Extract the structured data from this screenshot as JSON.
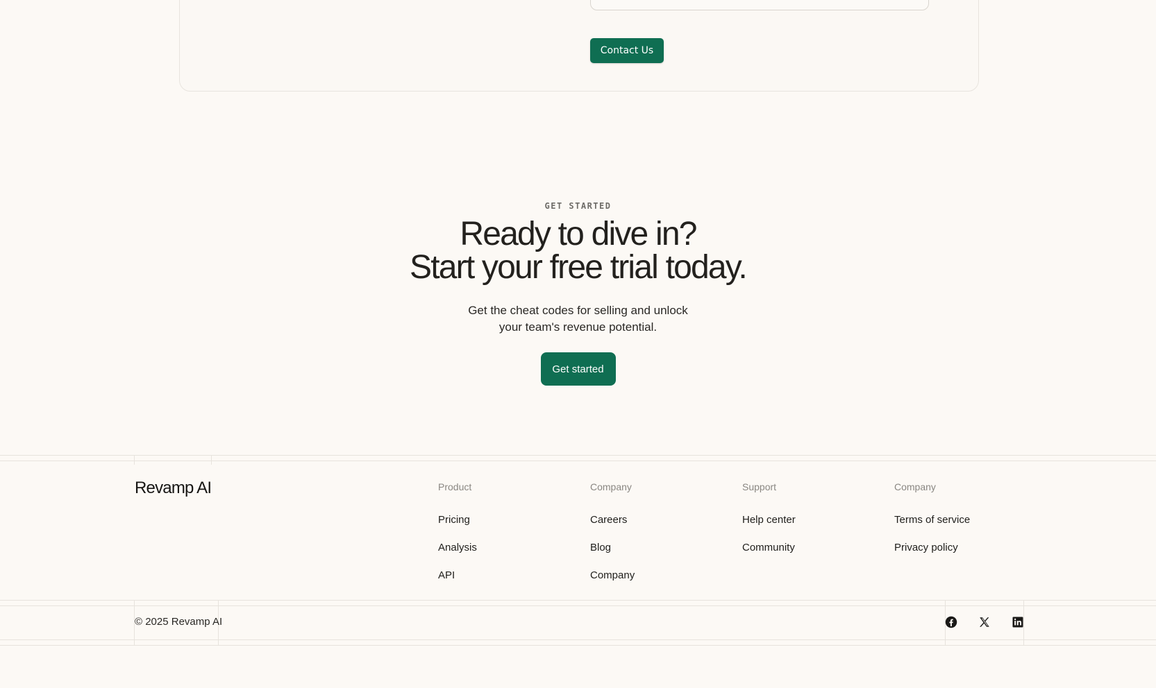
{
  "contact": {
    "button_label": "Contact Us"
  },
  "cta": {
    "eyebrow": "GET STARTED",
    "title_line1": "Ready to dive in?",
    "title_line2": "Start your free trial today.",
    "subtitle_line1": "Get the cheat codes for selling and unlock",
    "subtitle_line2": "your team's revenue potential.",
    "button_label": "Get started"
  },
  "footer": {
    "brand": "Revamp AI",
    "columns": [
      {
        "heading": "Product",
        "links": [
          "Pricing",
          "Analysis",
          "API"
        ]
      },
      {
        "heading": "Company",
        "links": [
          "Careers",
          "Blog",
          "Company"
        ]
      },
      {
        "heading": "Support",
        "links": [
          "Help center",
          "Community"
        ]
      },
      {
        "heading": "Company",
        "links": [
          "Terms of service",
          "Privacy policy"
        ]
      }
    ],
    "copyright": "© 2025 Revamp AI",
    "social": [
      "facebook-icon",
      "x-icon",
      "linkedin-icon"
    ]
  },
  "colors": {
    "background": "#fcf9f5",
    "accent": "#0f6e52",
    "text": "#1c1b19",
    "muted": "#8a8782"
  }
}
